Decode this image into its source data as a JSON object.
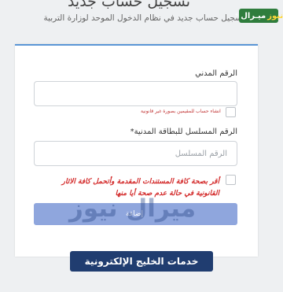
{
  "header": {
    "title": "تسجيل حساب جديد",
    "subtitle": "سجيل حساب جديد في نظام الدخول الموحد لوزارة التربية",
    "brand": {
      "main": "ميـرال",
      "accent": "نيوز"
    }
  },
  "form": {
    "civil_id_label": "الرقم المدني",
    "civil_id_value": "",
    "minor_account_note": "انشاء حساب للمقيمين بصورة غير قانونية",
    "serial_label": "الرقم المسلسل للبطاقة المدنية",
    "serial_required_mark": "*",
    "serial_placeholder": "الرقم المسلسل",
    "declaration_text": "أقر بصحة كافة المستندات المقدمة وأتحمل كافة الاثار القانونية في حالة عدم صحة أيا منها",
    "submit_label": "إضافة"
  },
  "watermark_text": "ميرال نيوز",
  "banner_text": "خدمات الخليج الإلكترونية",
  "colors": {
    "accent": "#5a95d6",
    "button": "#8fa6dd",
    "warning": "#d32a2a",
    "banner": "#203d70",
    "brand": "#2f7d3d"
  }
}
